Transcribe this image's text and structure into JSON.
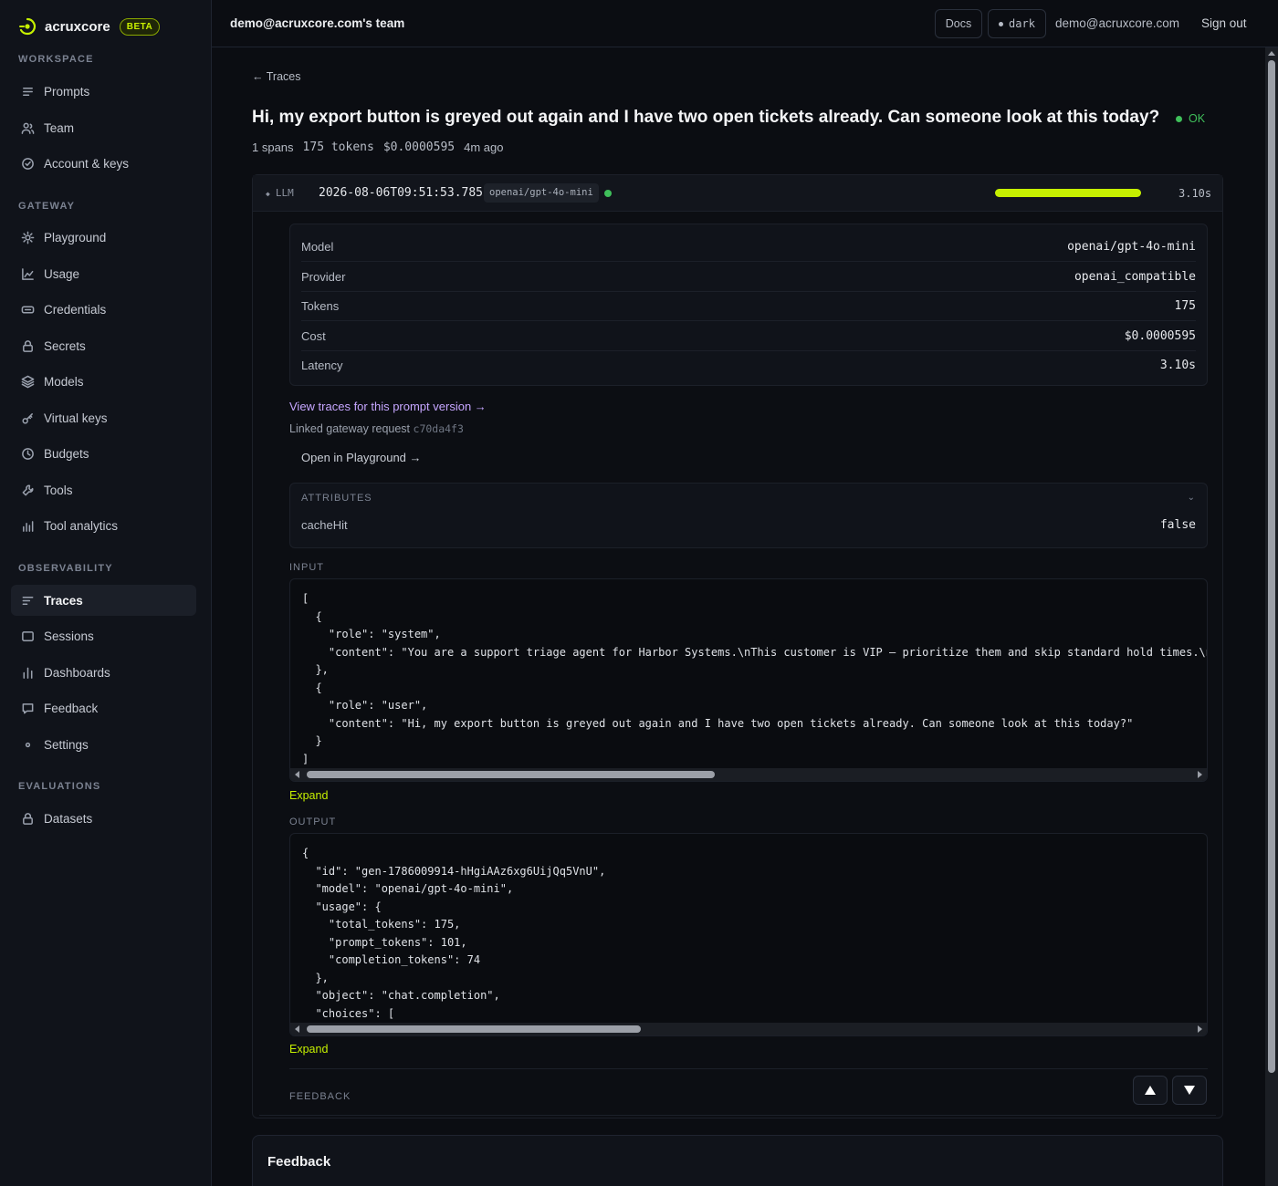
{
  "brand": {
    "name": "acruxcore",
    "badge": "BETA"
  },
  "sidebar": {
    "sections": [
      {
        "label": "WORKSPACE",
        "items": [
          "Prompts",
          "Team",
          "Account & keys"
        ]
      },
      {
        "label": "GATEWAY",
        "items": [
          "Playground",
          "Usage",
          "Credentials",
          "Secrets",
          "Models",
          "Virtual keys",
          "Budgets",
          "Tools",
          "Tool analytics"
        ]
      },
      {
        "label": "OBSERVABILITY",
        "items": [
          "Traces",
          "Sessions",
          "Dashboards",
          "Feedback",
          "Settings"
        ]
      },
      {
        "label": "EVALUATIONS",
        "items": [
          "Datasets"
        ]
      }
    ],
    "active": "Traces"
  },
  "header": {
    "team": "demo@acruxcore.com's team",
    "docs": "Docs",
    "theme": "dark",
    "email": "demo@acruxcore.com",
    "signout": "Sign out"
  },
  "trace": {
    "back": "← Traces",
    "title": "Hi, my export button is greyed out again and I have two open tickets already. Can someone look at this today?",
    "status": "OK",
    "spans": "1 spans",
    "tokens": "175 tokens",
    "cost": "$0.0000595",
    "ago": "4m ago"
  },
  "span": {
    "kind": "LLM",
    "time": "2026-08-06T09:51:53.785Z",
    "model": "openai/gpt-4o-mini",
    "latency": "3.10s",
    "bar_fraction": 1.0,
    "details": [
      {
        "key": "Model",
        "value": "openai/gpt-4o-mini"
      },
      {
        "key": "Provider",
        "value": "openai_compatible"
      },
      {
        "key": "Tokens",
        "value": "175"
      },
      {
        "key": "Cost",
        "value": "$0.0000595"
      },
      {
        "key": "Latency",
        "value": "3.10s"
      }
    ],
    "view_traces": "View traces for this prompt version →",
    "linked_label": "Linked gateway request",
    "linked_id": "c70da4f3",
    "open_playground": "Open in Playground →",
    "attributes_label": "ATTRIBUTES",
    "attributes": [
      {
        "key": "cacheHit",
        "value": "false"
      }
    ],
    "input_label": "INPUT",
    "input_lines": [
      "[",
      "  {",
      "    \"role\": \"system\",",
      "    \"content\": \"You are a support triage agent for Harbor Systems.\\nThis customer is VIP — prioritize them and skip standard hold times.\\n",
      "  },",
      "  {",
      "    \"role\": \"user\",",
      "    \"content\": \"Hi, my export button is greyed out again and I have two open tickets already. Can someone look at this today?\"",
      "  }",
      "]"
    ],
    "output_label": "OUTPUT",
    "output_lines": [
      "{",
      "  \"id\": \"gen-1786009914-hHgiAAz6xg6UijQq5VnU\",",
      "  \"model\": \"openai/gpt-4o-mini\",",
      "  \"usage\": {",
      "    \"total_tokens\": 175,",
      "    \"prompt_tokens\": 101,",
      "    \"completion_tokens\": 74",
      "  },",
      "  \"object\": \"chat.completion\",",
      "  \"choices\": ["
    ],
    "expand": "Expand",
    "feedback_label": "FEEDBACK"
  },
  "feedback_card": {
    "title": "Feedback"
  },
  "colors": {
    "accent": "#c6f000",
    "ok": "#3fbf5a",
    "link": "#c6a6ff"
  }
}
